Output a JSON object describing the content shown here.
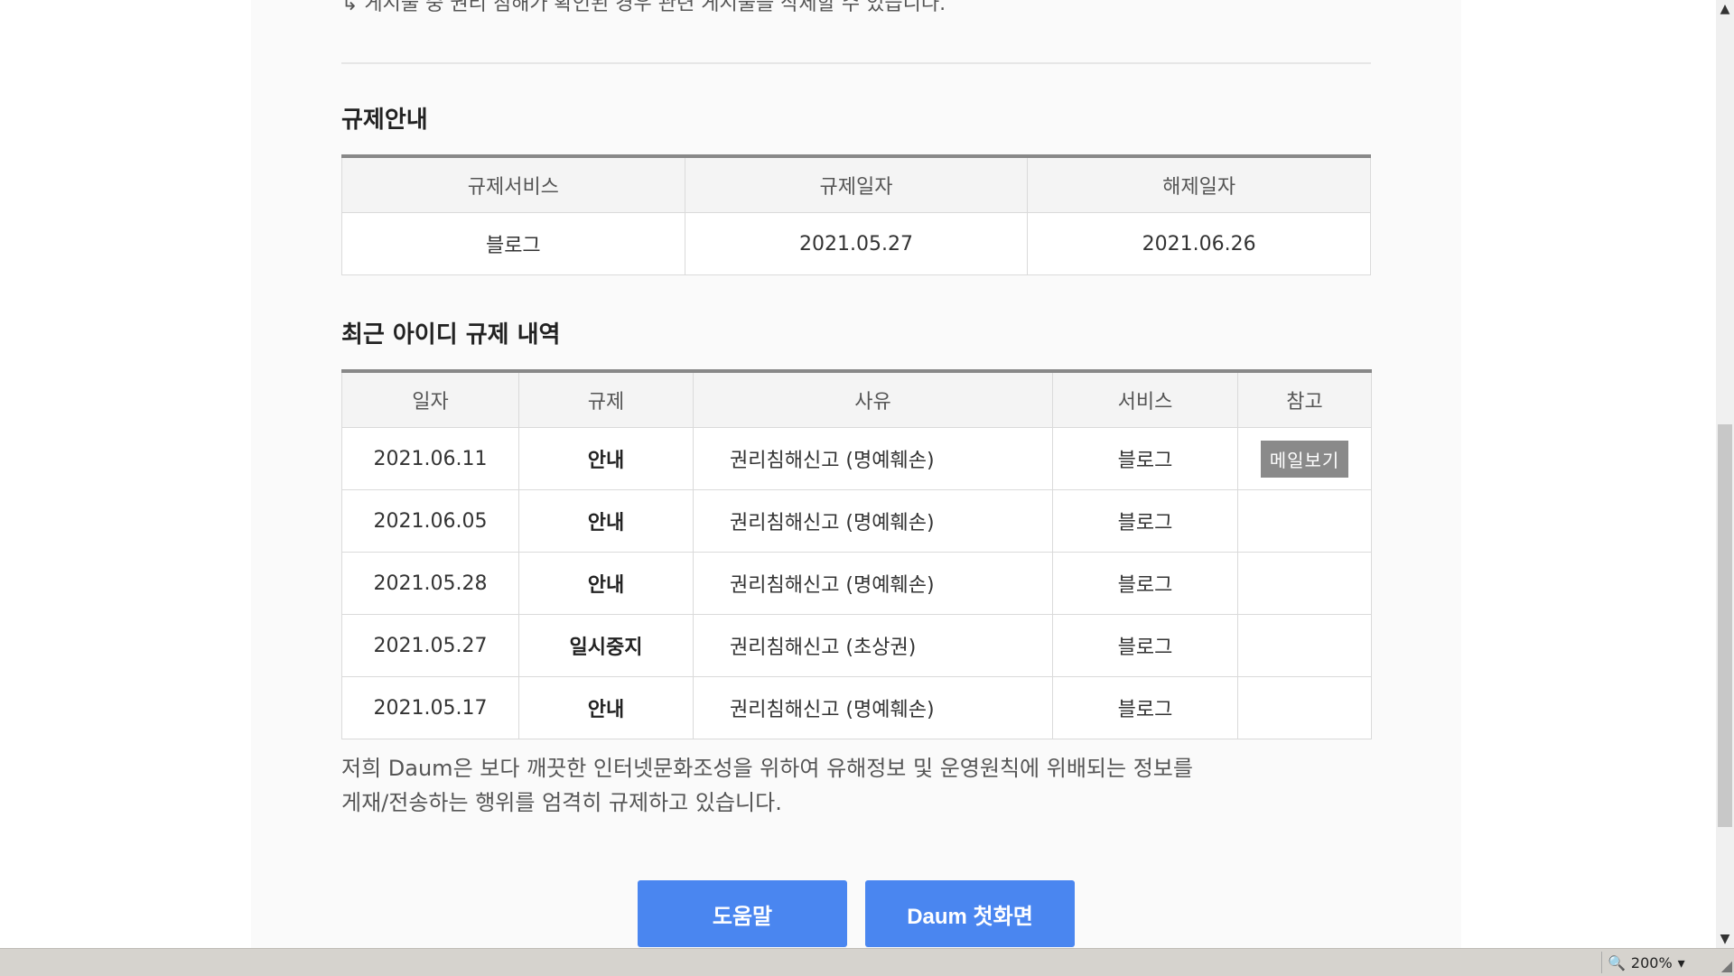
{
  "cut_text": "↳ 게시물 중 권리 침해가 확인된 경우 관련 게시물을 삭제할 수 있습니다.",
  "restriction_info": {
    "title": "규제안내",
    "headers": [
      "규제서비스",
      "규제일자",
      "해제일자"
    ],
    "row": [
      "블로그",
      "2021.05.27",
      "2021.06.26"
    ]
  },
  "history": {
    "title": "최근 아이디 규제 내역",
    "headers": [
      "일자",
      "규제",
      "사유",
      "서비스",
      "참고"
    ],
    "rows": [
      {
        "date": "2021.06.11",
        "action": "안내",
        "reason": "권리침해신고 (명예훼손)",
        "service": "블로그",
        "note": "메일보기"
      },
      {
        "date": "2021.06.05",
        "action": "안내",
        "reason": "권리침해신고 (명예훼손)",
        "service": "블로그",
        "note": ""
      },
      {
        "date": "2021.05.28",
        "action": "안내",
        "reason": "권리침해신고 (명예훼손)",
        "service": "블로그",
        "note": ""
      },
      {
        "date": "2021.05.27",
        "action": "일시중지",
        "reason": "권리침해신고 (초상권)",
        "service": "블로그",
        "note": ""
      },
      {
        "date": "2021.05.17",
        "action": "안내",
        "reason": "권리침해신고 (명예훼손)",
        "service": "블로그",
        "note": ""
      }
    ]
  },
  "notice": {
    "line1": "저희 Daum은 보다 깨끗한 인터넷문화조성을 위하여 유해정보 및 운영원칙에 위배되는 정보를",
    "line2": "게재/전송하는 행위를 엄격히 규제하고 있습니다."
  },
  "buttons": {
    "help": "도움말",
    "home": "Daum 첫화면"
  },
  "status": {
    "zoom": "200%"
  },
  "colors": {
    "button": "#4a86f0",
    "mail_button": "#8a8a8a"
  }
}
